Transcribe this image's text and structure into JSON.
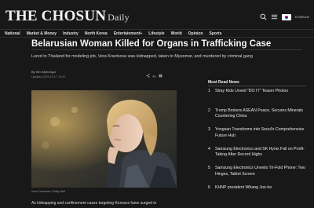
{
  "header": {
    "logo_main": "THE CHOSUN",
    "logo_sub": "Daily",
    "language_label": "KOREAN",
    "icons": [
      "search-icon",
      "menu-icon",
      "flag-icon"
    ]
  },
  "nav": {
    "items": [
      "National",
      "Market & Money",
      "Industry",
      "North Korea",
      "Entertainment+",
      "Lifestyle",
      "World",
      "Opinion",
      "Sports"
    ]
  },
  "article": {
    "headline": "Belarusian Woman Killed for Organs in Trafficking Case",
    "subhead": "Lured to Thailand for modeling job, Vera Kravtsova was kidnapped, taken to Myanmar, and murdered by criminal gang",
    "byline": "By Kim Myeong-il",
    "updated": "Updated 2025.10.17. 16:47",
    "tool_icons": [
      "share-icon",
      "font-size-icon",
      "print-icon"
    ],
    "photo_caption": "Vera Kravtsova. /Daily Mail",
    "body_start": "As kidnapping and confinement cases targeting Koreans have surged in"
  },
  "sidebar": {
    "title": "Most Read News",
    "items": [
      {
        "num": "1",
        "text": "Stray Kids Unveil \"DO IT\" Teaser Photos"
      },
      {
        "num": "2",
        "text": "Trump Brokers ASEAN Peace, Secures Minerals Countering China"
      },
      {
        "num": "3",
        "text": "Yongsan Transforms into Seoul's Comprehensive Future Hub"
      },
      {
        "num": "4",
        "text": "Samsung Electronics and SK Hynix Fall on Profit-Taking After Record Highs"
      },
      {
        "num": "5",
        "text": "Samsung Electronics Unveils Tri-Fold Phone: Two Hinges, Tablet Screen"
      },
      {
        "num": "6",
        "text": "KHNP president Whang Joo-ho"
      }
    ]
  },
  "colors": {
    "background": "#181818",
    "text": "#e8e8e8",
    "muted": "#9a9a9a"
  }
}
